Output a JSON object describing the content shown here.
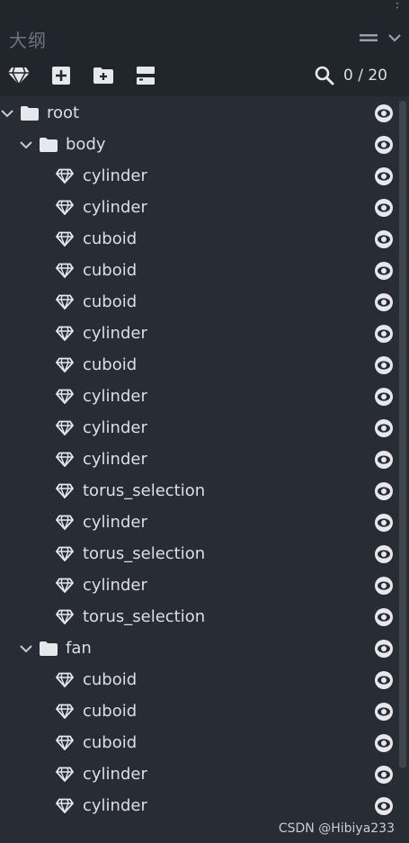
{
  "panel": {
    "title": "大纲",
    "counter": "0 / 20"
  },
  "toolbar": {
    "buttons": [
      {
        "name": "add-mesh-button",
        "icon": "gem-icon"
      },
      {
        "name": "add-element-button",
        "icon": "plus-square-icon"
      },
      {
        "name": "add-group-button",
        "icon": "folder-plus-icon"
      },
      {
        "name": "sort-button",
        "icon": "split-icon"
      }
    ]
  },
  "tree": [
    {
      "label": "root",
      "type": "folder",
      "depth": 0,
      "expanded": true
    },
    {
      "label": "body",
      "type": "folder",
      "depth": 1,
      "expanded": true
    },
    {
      "label": "cylinder",
      "type": "mesh",
      "depth": 2
    },
    {
      "label": "cylinder",
      "type": "mesh",
      "depth": 2
    },
    {
      "label": "cuboid",
      "type": "mesh",
      "depth": 2
    },
    {
      "label": "cuboid",
      "type": "mesh",
      "depth": 2
    },
    {
      "label": "cuboid",
      "type": "mesh",
      "depth": 2
    },
    {
      "label": "cylinder",
      "type": "mesh",
      "depth": 2
    },
    {
      "label": "cuboid",
      "type": "mesh",
      "depth": 2
    },
    {
      "label": "cylinder",
      "type": "mesh",
      "depth": 2
    },
    {
      "label": "cylinder",
      "type": "mesh",
      "depth": 2
    },
    {
      "label": "cylinder",
      "type": "mesh",
      "depth": 2
    },
    {
      "label": "torus_selection",
      "type": "mesh",
      "depth": 2
    },
    {
      "label": "cylinder",
      "type": "mesh",
      "depth": 2
    },
    {
      "label": "torus_selection",
      "type": "mesh",
      "depth": 2
    },
    {
      "label": "cylinder",
      "type": "mesh",
      "depth": 2
    },
    {
      "label": "torus_selection",
      "type": "mesh",
      "depth": 2
    },
    {
      "label": "fan",
      "type": "folder",
      "depth": 1,
      "expanded": true
    },
    {
      "label": "cuboid",
      "type": "mesh",
      "depth": 2
    },
    {
      "label": "cuboid",
      "type": "mesh",
      "depth": 2
    },
    {
      "label": "cuboid",
      "type": "mesh",
      "depth": 2
    },
    {
      "label": "cylinder",
      "type": "mesh",
      "depth": 2
    },
    {
      "label": "cylinder",
      "type": "mesh",
      "depth": 2
    }
  ],
  "watermark": "CSDN @Hibiya233",
  "colors": {
    "background": "#21252c",
    "tree_background": "#282c34",
    "text": "#dcdfe4",
    "muted": "#6f7581"
  }
}
